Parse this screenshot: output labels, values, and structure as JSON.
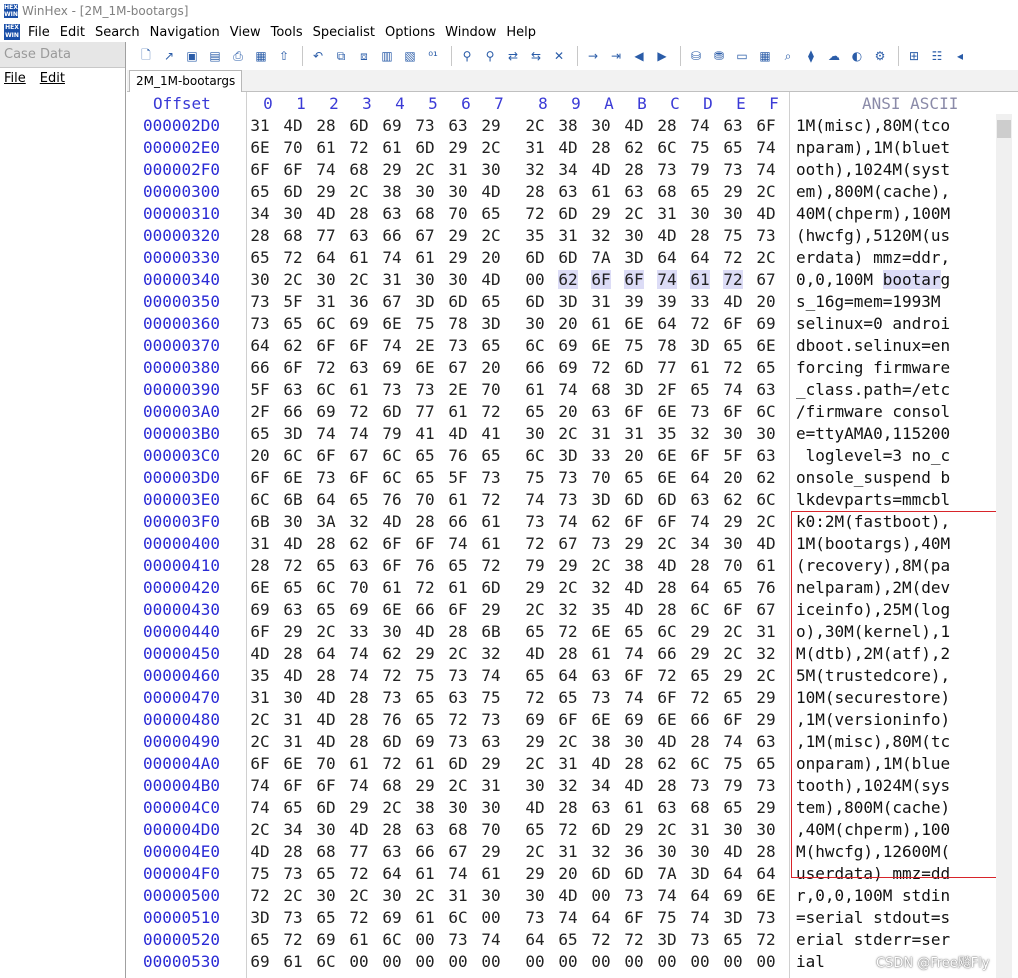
{
  "window": {
    "title": "WinHex - [2M_1M-bootargs]"
  },
  "menu": [
    "File",
    "Edit",
    "Search",
    "Navigation",
    "View",
    "Tools",
    "Specialist",
    "Options",
    "Window",
    "Help"
  ],
  "case_panel": {
    "header": "Case Data",
    "menu": [
      "File",
      "Edit"
    ]
  },
  "tab": {
    "label": "2M_1M-bootargs"
  },
  "header": {
    "offset": "Offset",
    "columns": [
      "0",
      "1",
      "2",
      "3",
      "4",
      "5",
      "6",
      "7",
      "8",
      "9",
      "A",
      "B",
      "C",
      "D",
      "E",
      "F"
    ],
    "ascii": "ANSI ASCII"
  },
  "rows": [
    {
      "offset": "000002D0",
      "bytes": [
        "31",
        "4D",
        "28",
        "6D",
        "69",
        "73",
        "63",
        "29",
        "2C",
        "38",
        "30",
        "4D",
        "28",
        "74",
        "63",
        "6F"
      ],
      "ascii": "1M(misc),80M(tco"
    },
    {
      "offset": "000002E0",
      "bytes": [
        "6E",
        "70",
        "61",
        "72",
        "61",
        "6D",
        "29",
        "2C",
        "31",
        "4D",
        "28",
        "62",
        "6C",
        "75",
        "65",
        "74"
      ],
      "ascii": "nparam),1M(bluet"
    },
    {
      "offset": "000002F0",
      "bytes": [
        "6F",
        "6F",
        "74",
        "68",
        "29",
        "2C",
        "31",
        "30",
        "32",
        "34",
        "4D",
        "28",
        "73",
        "79",
        "73",
        "74"
      ],
      "ascii": "ooth),1024M(syst"
    },
    {
      "offset": "00000300",
      "bytes": [
        "65",
        "6D",
        "29",
        "2C",
        "38",
        "30",
        "30",
        "4D",
        "28",
        "63",
        "61",
        "63",
        "68",
        "65",
        "29",
        "2C"
      ],
      "ascii": "em),800M(cache),"
    },
    {
      "offset": "00000310",
      "bytes": [
        "34",
        "30",
        "4D",
        "28",
        "63",
        "68",
        "70",
        "65",
        "72",
        "6D",
        "29",
        "2C",
        "31",
        "30",
        "30",
        "4D"
      ],
      "ascii": "40M(chperm),100M"
    },
    {
      "offset": "00000320",
      "bytes": [
        "28",
        "68",
        "77",
        "63",
        "66",
        "67",
        "29",
        "2C",
        "35",
        "31",
        "32",
        "30",
        "4D",
        "28",
        "75",
        "73"
      ],
      "ascii": "(hwcfg),5120M(us"
    },
    {
      "offset": "00000330",
      "bytes": [
        "65",
        "72",
        "64",
        "61",
        "74",
        "61",
        "29",
        "20",
        "6D",
        "6D",
        "7A",
        "3D",
        "64",
        "64",
        "72",
        "2C"
      ],
      "ascii": "erdata) mmz=ddr,"
    },
    {
      "offset": "00000340",
      "bytes": [
        "30",
        "2C",
        "30",
        "2C",
        "31",
        "30",
        "30",
        "4D",
        "00",
        "62",
        "6F",
        "6F",
        "74",
        "61",
        "72",
        "67"
      ],
      "ascii": "0,0,100M bootarg",
      "sel_bytes": [
        9,
        10,
        11,
        12,
        13,
        14
      ],
      "sel_ascii_from": 9,
      "sel_ascii_to": 15
    },
    {
      "offset": "00000350",
      "bytes": [
        "73",
        "5F",
        "31",
        "36",
        "67",
        "3D",
        "6D",
        "65",
        "6D",
        "3D",
        "31",
        "39",
        "39",
        "33",
        "4D",
        "20"
      ],
      "ascii": "s_16g=mem=1993M "
    },
    {
      "offset": "00000360",
      "bytes": [
        "73",
        "65",
        "6C",
        "69",
        "6E",
        "75",
        "78",
        "3D",
        "30",
        "20",
        "61",
        "6E",
        "64",
        "72",
        "6F",
        "69"
      ],
      "ascii": "selinux=0 androi"
    },
    {
      "offset": "00000370",
      "bytes": [
        "64",
        "62",
        "6F",
        "6F",
        "74",
        "2E",
        "73",
        "65",
        "6C",
        "69",
        "6E",
        "75",
        "78",
        "3D",
        "65",
        "6E"
      ],
      "ascii": "dboot.selinux=en"
    },
    {
      "offset": "00000380",
      "bytes": [
        "66",
        "6F",
        "72",
        "63",
        "69",
        "6E",
        "67",
        "20",
        "66",
        "69",
        "72",
        "6D",
        "77",
        "61",
        "72",
        "65"
      ],
      "ascii": "forcing firmware"
    },
    {
      "offset": "00000390",
      "bytes": [
        "5F",
        "63",
        "6C",
        "61",
        "73",
        "73",
        "2E",
        "70",
        "61",
        "74",
        "68",
        "3D",
        "2F",
        "65",
        "74",
        "63"
      ],
      "ascii": "_class.path=/etc"
    },
    {
      "offset": "000003A0",
      "bytes": [
        "2F",
        "66",
        "69",
        "72",
        "6D",
        "77",
        "61",
        "72",
        "65",
        "20",
        "63",
        "6F",
        "6E",
        "73",
        "6F",
        "6C"
      ],
      "ascii": "/firmware consol"
    },
    {
      "offset": "000003B0",
      "bytes": [
        "65",
        "3D",
        "74",
        "74",
        "79",
        "41",
        "4D",
        "41",
        "30",
        "2C",
        "31",
        "31",
        "35",
        "32",
        "30",
        "30"
      ],
      "ascii": "e=ttyAMA0,115200"
    },
    {
      "offset": "000003C0",
      "bytes": [
        "20",
        "6C",
        "6F",
        "67",
        "6C",
        "65",
        "76",
        "65",
        "6C",
        "3D",
        "33",
        "20",
        "6E",
        "6F",
        "5F",
        "63"
      ],
      "ascii": " loglevel=3 no_c"
    },
    {
      "offset": "000003D0",
      "bytes": [
        "6F",
        "6E",
        "73",
        "6F",
        "6C",
        "65",
        "5F",
        "73",
        "75",
        "73",
        "70",
        "65",
        "6E",
        "64",
        "20",
        "62"
      ],
      "ascii": "onsole_suspend b"
    },
    {
      "offset": "000003E0",
      "bytes": [
        "6C",
        "6B",
        "64",
        "65",
        "76",
        "70",
        "61",
        "72",
        "74",
        "73",
        "3D",
        "6D",
        "6D",
        "63",
        "62",
        "6C"
      ],
      "ascii": "lkdevparts=mmcbl"
    },
    {
      "offset": "000003F0",
      "bytes": [
        "6B",
        "30",
        "3A",
        "32",
        "4D",
        "28",
        "66",
        "61",
        "73",
        "74",
        "62",
        "6F",
        "6F",
        "74",
        "29",
        "2C"
      ],
      "ascii": "k0:2M(fastboot),"
    },
    {
      "offset": "00000400",
      "bytes": [
        "31",
        "4D",
        "28",
        "62",
        "6F",
        "6F",
        "74",
        "61",
        "72",
        "67",
        "73",
        "29",
        "2C",
        "34",
        "30",
        "4D"
      ],
      "ascii": "1M(bootargs),40M"
    },
    {
      "offset": "00000410",
      "bytes": [
        "28",
        "72",
        "65",
        "63",
        "6F",
        "76",
        "65",
        "72",
        "79",
        "29",
        "2C",
        "38",
        "4D",
        "28",
        "70",
        "61"
      ],
      "ascii": "(recovery),8M(pa"
    },
    {
      "offset": "00000420",
      "bytes": [
        "6E",
        "65",
        "6C",
        "70",
        "61",
        "72",
        "61",
        "6D",
        "29",
        "2C",
        "32",
        "4D",
        "28",
        "64",
        "65",
        "76"
      ],
      "ascii": "nelparam),2M(dev"
    },
    {
      "offset": "00000430",
      "bytes": [
        "69",
        "63",
        "65",
        "69",
        "6E",
        "66",
        "6F",
        "29",
        "2C",
        "32",
        "35",
        "4D",
        "28",
        "6C",
        "6F",
        "67"
      ],
      "ascii": "iceinfo),25M(log"
    },
    {
      "offset": "00000440",
      "bytes": [
        "6F",
        "29",
        "2C",
        "33",
        "30",
        "4D",
        "28",
        "6B",
        "65",
        "72",
        "6E",
        "65",
        "6C",
        "29",
        "2C",
        "31"
      ],
      "ascii": "o),30M(kernel),1"
    },
    {
      "offset": "00000450",
      "bytes": [
        "4D",
        "28",
        "64",
        "74",
        "62",
        "29",
        "2C",
        "32",
        "4D",
        "28",
        "61",
        "74",
        "66",
        "29",
        "2C",
        "32"
      ],
      "ascii": "M(dtb),2M(atf),2"
    },
    {
      "offset": "00000460",
      "bytes": [
        "35",
        "4D",
        "28",
        "74",
        "72",
        "75",
        "73",
        "74",
        "65",
        "64",
        "63",
        "6F",
        "72",
        "65",
        "29",
        "2C"
      ],
      "ascii": "5M(trustedcore),"
    },
    {
      "offset": "00000470",
      "bytes": [
        "31",
        "30",
        "4D",
        "28",
        "73",
        "65",
        "63",
        "75",
        "72",
        "65",
        "73",
        "74",
        "6F",
        "72",
        "65",
        "29"
      ],
      "ascii": "10M(securestore)"
    },
    {
      "offset": "00000480",
      "bytes": [
        "2C",
        "31",
        "4D",
        "28",
        "76",
        "65",
        "72",
        "73",
        "69",
        "6F",
        "6E",
        "69",
        "6E",
        "66",
        "6F",
        "29"
      ],
      "ascii": ",1M(versioninfo)"
    },
    {
      "offset": "00000490",
      "bytes": [
        "2C",
        "31",
        "4D",
        "28",
        "6D",
        "69",
        "73",
        "63",
        "29",
        "2C",
        "38",
        "30",
        "4D",
        "28",
        "74",
        "63"
      ],
      "ascii": ",1M(misc),80M(tc"
    },
    {
      "offset": "000004A0",
      "bytes": [
        "6F",
        "6E",
        "70",
        "61",
        "72",
        "61",
        "6D",
        "29",
        "2C",
        "31",
        "4D",
        "28",
        "62",
        "6C",
        "75",
        "65"
      ],
      "ascii": "onparam),1M(blue"
    },
    {
      "offset": "000004B0",
      "bytes": [
        "74",
        "6F",
        "6F",
        "74",
        "68",
        "29",
        "2C",
        "31",
        "30",
        "32",
        "34",
        "4D",
        "28",
        "73",
        "79",
        "73"
      ],
      "ascii": "tooth),1024M(sys"
    },
    {
      "offset": "000004C0",
      "bytes": [
        "74",
        "65",
        "6D",
        "29",
        "2C",
        "38",
        "30",
        "30",
        "4D",
        "28",
        "63",
        "61",
        "63",
        "68",
        "65",
        "29"
      ],
      "ascii": "tem),800M(cache)"
    },
    {
      "offset": "000004D0",
      "bytes": [
        "2C",
        "34",
        "30",
        "4D",
        "28",
        "63",
        "68",
        "70",
        "65",
        "72",
        "6D",
        "29",
        "2C",
        "31",
        "30",
        "30"
      ],
      "ascii": ",40M(chperm),100"
    },
    {
      "offset": "000004E0",
      "bytes": [
        "4D",
        "28",
        "68",
        "77",
        "63",
        "66",
        "67",
        "29",
        "2C",
        "31",
        "32",
        "36",
        "30",
        "30",
        "4D",
        "28"
      ],
      "ascii": "M(hwcfg),12600M("
    },
    {
      "offset": "000004F0",
      "bytes": [
        "75",
        "73",
        "65",
        "72",
        "64",
        "61",
        "74",
        "61",
        "29",
        "20",
        "6D",
        "6D",
        "7A",
        "3D",
        "64",
        "64"
      ],
      "ascii": "userdata) mmz=dd"
    },
    {
      "offset": "00000500",
      "bytes": [
        "72",
        "2C",
        "30",
        "2C",
        "30",
        "2C",
        "31",
        "30",
        "30",
        "4D",
        "00",
        "73",
        "74",
        "64",
        "69",
        "6E"
      ],
      "ascii": "r,0,0,100M stdin"
    },
    {
      "offset": "00000510",
      "bytes": [
        "3D",
        "73",
        "65",
        "72",
        "69",
        "61",
        "6C",
        "00",
        "73",
        "74",
        "64",
        "6F",
        "75",
        "74",
        "3D",
        "73"
      ],
      "ascii": "=serial stdout=s"
    },
    {
      "offset": "00000520",
      "bytes": [
        "65",
        "72",
        "69",
        "61",
        "6C",
        "00",
        "73",
        "74",
        "64",
        "65",
        "72",
        "72",
        "3D",
        "73",
        "65",
        "72"
      ],
      "ascii": "erial stderr=ser"
    },
    {
      "offset": "00000530",
      "bytes": [
        "69",
        "61",
        "6C",
        "00",
        "00",
        "00",
        "00",
        "00",
        "00",
        "00",
        "00",
        "00",
        "00",
        "00",
        "00",
        "00"
      ],
      "ascii": "ial             "
    }
  ],
  "watermark": "CSDN @Free飚Fly"
}
